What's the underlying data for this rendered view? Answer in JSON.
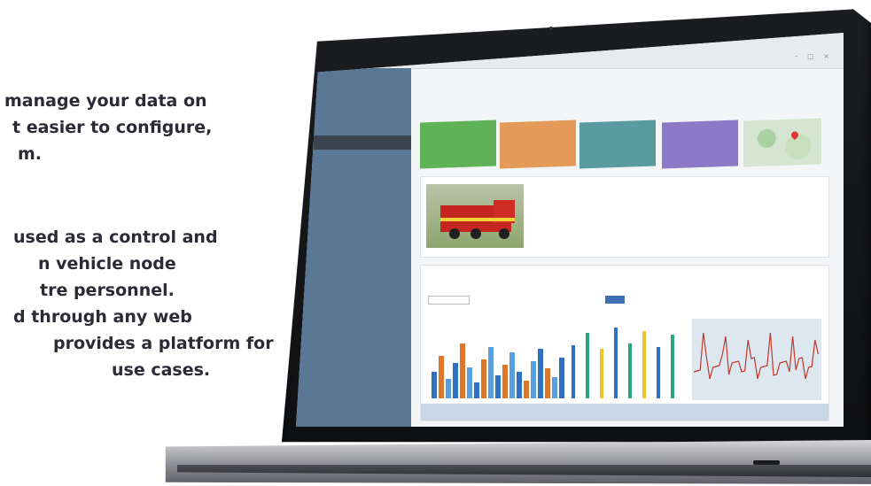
{
  "marketing": {
    "paragraph1": [
      "manage your data on",
      "t easier to configure,",
      "m."
    ],
    "paragraph2": [
      "used as a control and",
      "n vehicle node",
      "tre personnel.",
      "d through any web",
      "provides a platform for",
      "use cases."
    ]
  },
  "colors": {
    "sidebar": "#5b7796",
    "sidebar_active": "#3b4451",
    "card_green": "#5fb356",
    "card_orange": "#e49b59",
    "card_teal": "#5a9aa1",
    "card_purple": "#8a7ac8",
    "apply_button": "#3d6fb2"
  }
}
